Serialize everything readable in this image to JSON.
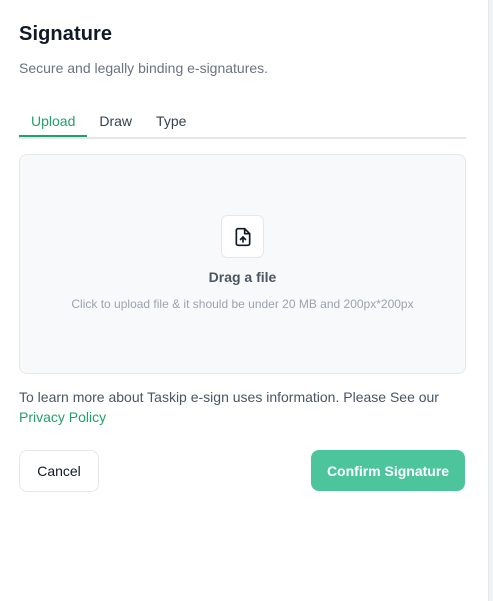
{
  "modal": {
    "title": "Signature",
    "subtitle": "Secure and legally binding e-signatures."
  },
  "tabs": [
    {
      "label": "Upload",
      "active": true
    },
    {
      "label": "Draw",
      "active": false
    },
    {
      "label": "Type",
      "active": false
    }
  ],
  "dropzone": {
    "icon": "file-upload-icon",
    "title": "Drag a file",
    "hint": "Click to upload file & it should be under 20 MB and 200px*200px"
  },
  "info": {
    "text": "To learn more about Taskip e-sign uses information. Please See our ",
    "link_label": "Privacy Policy"
  },
  "actions": {
    "cancel_label": "Cancel",
    "confirm_label": "Confirm Signature"
  },
  "colors": {
    "accent": "#22a06b",
    "confirm_bg": "#4cc59c",
    "muted_text": "#6b7280"
  }
}
